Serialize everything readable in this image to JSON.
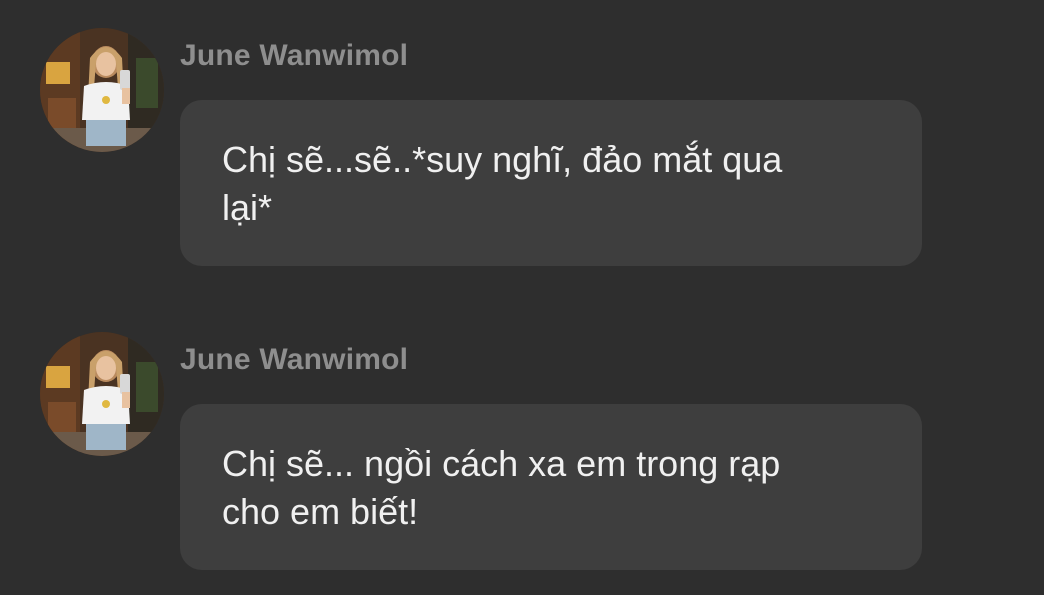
{
  "messages": [
    {
      "sender": "June Wanwimol",
      "avatar_icon": "profile-photo",
      "text": "Chị sẽ...sẽ..*suy nghĩ, đảo mắt qua lại*"
    },
    {
      "sender": "June Wanwimol",
      "avatar_icon": "profile-photo",
      "text": "Chị sẽ... ngồi cách xa em trong rạp cho em biết!"
    }
  ],
  "colors": {
    "background": "#2e2e2e",
    "bubble": "#3e3e3e",
    "sender_name": "#8e8e8e",
    "message_text": "#f0f0f0"
  }
}
